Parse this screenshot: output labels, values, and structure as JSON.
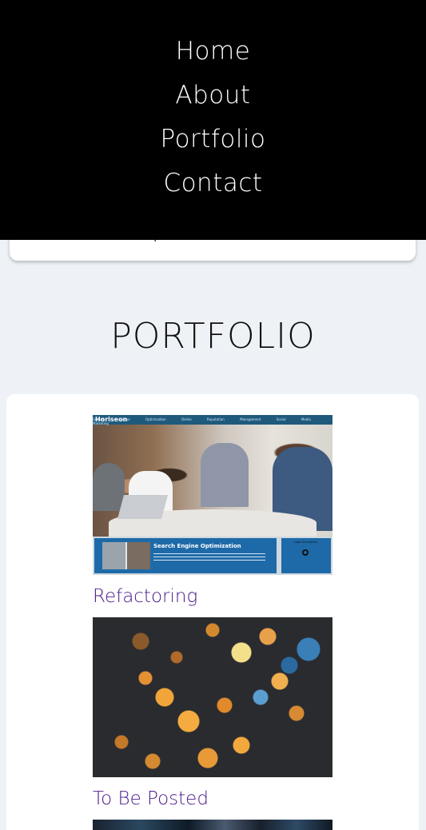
{
  "nav": {
    "items": [
      {
        "label": "Home"
      },
      {
        "label": "About"
      },
      {
        "label": "Portfolio"
      },
      {
        "label": "Contact"
      }
    ]
  },
  "about": {
    "partial_text": "rare molestias dolorem ipsa sunt autem laboriosam."
  },
  "portfolio": {
    "title": "PORTFOLIO",
    "projects": [
      {
        "title": "Refactoring",
        "thumb": {
          "brand": "Horiseon",
          "nav": "Search Engine Optimization   Online Reputation Management   Social Media Marketing",
          "heading": "Search Engine Optimization",
          "side_title": "Lead Generation"
        }
      },
      {
        "title": "To Be Posted"
      }
    ]
  },
  "colors": {
    "nav_bg": "#000000",
    "page_bg": "#eef2f6",
    "project_link": "#4a1a8a"
  }
}
